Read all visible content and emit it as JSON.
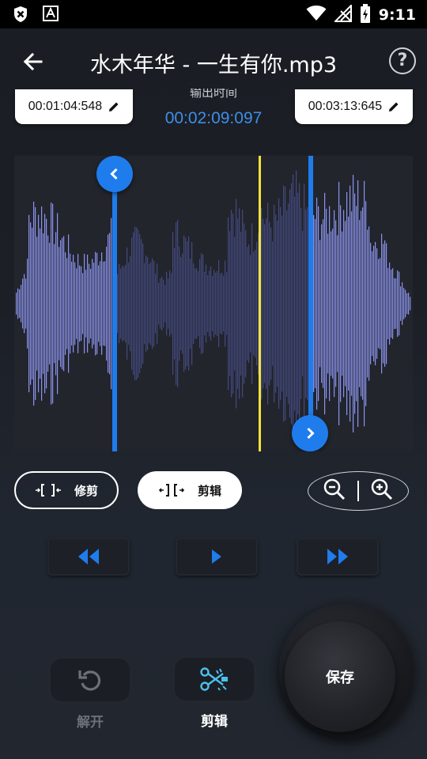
{
  "status_bar": {
    "time": "9:11"
  },
  "header": {
    "title": "水木年华 - 一生有你.mp3",
    "back_icon": "arrow-left-icon",
    "help_icon": "question-circle-icon"
  },
  "selection": {
    "start_time": "00:01:04:548",
    "end_time": "00:03:13:645",
    "output_label": "输出时间",
    "output_time": "00:02:09:097"
  },
  "modes": {
    "trim_label": "修剪",
    "cut_label": "剪辑",
    "active": "cut"
  },
  "tools": {
    "undo_label": "解开",
    "cut_label": "剪辑",
    "save_label": "保存"
  },
  "colors": {
    "accent": "#1f7cec",
    "playhead": "#f5e33a",
    "wave_active": "#8a93ec",
    "wave_dim": "#434a7e",
    "output_time": "#3d8fe8"
  }
}
